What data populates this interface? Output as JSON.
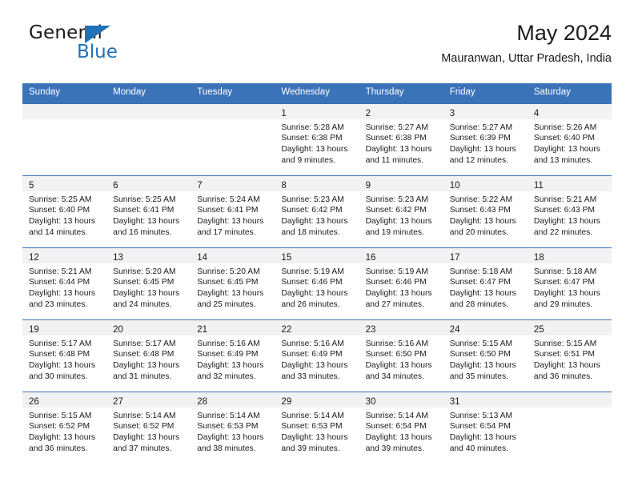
{
  "brand": {
    "word_one": "General",
    "word_two": "Blue",
    "triangle_icon": "triangle-icon",
    "accent_color": "#1f71b8"
  },
  "header": {
    "title": "May 2024",
    "subtitle": "Mauranwan, Uttar Pradesh, India"
  },
  "theme": {
    "header_blue": "#3b73b9",
    "daynum_band": "#f2f2f2",
    "text": "#1b1b1b"
  },
  "calendar": {
    "weekday_headers": [
      "Sunday",
      "Monday",
      "Tuesday",
      "Wednesday",
      "Thursday",
      "Friday",
      "Saturday"
    ],
    "weeks": [
      [
        {
          "day": "",
          "sunrise": "",
          "sunset": "",
          "daylight": ""
        },
        {
          "day": "",
          "sunrise": "",
          "sunset": "",
          "daylight": ""
        },
        {
          "day": "",
          "sunrise": "",
          "sunset": "",
          "daylight": ""
        },
        {
          "day": "1",
          "sunrise": "Sunrise: 5:28 AM",
          "sunset": "Sunset: 6:38 PM",
          "daylight": "Daylight: 13 hours and 9 minutes."
        },
        {
          "day": "2",
          "sunrise": "Sunrise: 5:27 AM",
          "sunset": "Sunset: 6:38 PM",
          "daylight": "Daylight: 13 hours and 11 minutes."
        },
        {
          "day": "3",
          "sunrise": "Sunrise: 5:27 AM",
          "sunset": "Sunset: 6:39 PM",
          "daylight": "Daylight: 13 hours and 12 minutes."
        },
        {
          "day": "4",
          "sunrise": "Sunrise: 5:26 AM",
          "sunset": "Sunset: 6:40 PM",
          "daylight": "Daylight: 13 hours and 13 minutes."
        }
      ],
      [
        {
          "day": "5",
          "sunrise": "Sunrise: 5:25 AM",
          "sunset": "Sunset: 6:40 PM",
          "daylight": "Daylight: 13 hours and 14 minutes."
        },
        {
          "day": "6",
          "sunrise": "Sunrise: 5:25 AM",
          "sunset": "Sunset: 6:41 PM",
          "daylight": "Daylight: 13 hours and 16 minutes."
        },
        {
          "day": "7",
          "sunrise": "Sunrise: 5:24 AM",
          "sunset": "Sunset: 6:41 PM",
          "daylight": "Daylight: 13 hours and 17 minutes."
        },
        {
          "day": "8",
          "sunrise": "Sunrise: 5:23 AM",
          "sunset": "Sunset: 6:42 PM",
          "daylight": "Daylight: 13 hours and 18 minutes."
        },
        {
          "day": "9",
          "sunrise": "Sunrise: 5:23 AM",
          "sunset": "Sunset: 6:42 PM",
          "daylight": "Daylight: 13 hours and 19 minutes."
        },
        {
          "day": "10",
          "sunrise": "Sunrise: 5:22 AM",
          "sunset": "Sunset: 6:43 PM",
          "daylight": "Daylight: 13 hours and 20 minutes."
        },
        {
          "day": "11",
          "sunrise": "Sunrise: 5:21 AM",
          "sunset": "Sunset: 6:43 PM",
          "daylight": "Daylight: 13 hours and 22 minutes."
        }
      ],
      [
        {
          "day": "12",
          "sunrise": "Sunrise: 5:21 AM",
          "sunset": "Sunset: 6:44 PM",
          "daylight": "Daylight: 13 hours and 23 minutes."
        },
        {
          "day": "13",
          "sunrise": "Sunrise: 5:20 AM",
          "sunset": "Sunset: 6:45 PM",
          "daylight": "Daylight: 13 hours and 24 minutes."
        },
        {
          "day": "14",
          "sunrise": "Sunrise: 5:20 AM",
          "sunset": "Sunset: 6:45 PM",
          "daylight": "Daylight: 13 hours and 25 minutes."
        },
        {
          "day": "15",
          "sunrise": "Sunrise: 5:19 AM",
          "sunset": "Sunset: 6:46 PM",
          "daylight": "Daylight: 13 hours and 26 minutes."
        },
        {
          "day": "16",
          "sunrise": "Sunrise: 5:19 AM",
          "sunset": "Sunset: 6:46 PM",
          "daylight": "Daylight: 13 hours and 27 minutes."
        },
        {
          "day": "17",
          "sunrise": "Sunrise: 5:18 AM",
          "sunset": "Sunset: 6:47 PM",
          "daylight": "Daylight: 13 hours and 28 minutes."
        },
        {
          "day": "18",
          "sunrise": "Sunrise: 5:18 AM",
          "sunset": "Sunset: 6:47 PM",
          "daylight": "Daylight: 13 hours and 29 minutes."
        }
      ],
      [
        {
          "day": "19",
          "sunrise": "Sunrise: 5:17 AM",
          "sunset": "Sunset: 6:48 PM",
          "daylight": "Daylight: 13 hours and 30 minutes."
        },
        {
          "day": "20",
          "sunrise": "Sunrise: 5:17 AM",
          "sunset": "Sunset: 6:48 PM",
          "daylight": "Daylight: 13 hours and 31 minutes."
        },
        {
          "day": "21",
          "sunrise": "Sunrise: 5:16 AM",
          "sunset": "Sunset: 6:49 PM",
          "daylight": "Daylight: 13 hours and 32 minutes."
        },
        {
          "day": "22",
          "sunrise": "Sunrise: 5:16 AM",
          "sunset": "Sunset: 6:49 PM",
          "daylight": "Daylight: 13 hours and 33 minutes."
        },
        {
          "day": "23",
          "sunrise": "Sunrise: 5:16 AM",
          "sunset": "Sunset: 6:50 PM",
          "daylight": "Daylight: 13 hours and 34 minutes."
        },
        {
          "day": "24",
          "sunrise": "Sunrise: 5:15 AM",
          "sunset": "Sunset: 6:50 PM",
          "daylight": "Daylight: 13 hours and 35 minutes."
        },
        {
          "day": "25",
          "sunrise": "Sunrise: 5:15 AM",
          "sunset": "Sunset: 6:51 PM",
          "daylight": "Daylight: 13 hours and 36 minutes."
        }
      ],
      [
        {
          "day": "26",
          "sunrise": "Sunrise: 5:15 AM",
          "sunset": "Sunset: 6:52 PM",
          "daylight": "Daylight: 13 hours and 36 minutes."
        },
        {
          "day": "27",
          "sunrise": "Sunrise: 5:14 AM",
          "sunset": "Sunset: 6:52 PM",
          "daylight": "Daylight: 13 hours and 37 minutes."
        },
        {
          "day": "28",
          "sunrise": "Sunrise: 5:14 AM",
          "sunset": "Sunset: 6:53 PM",
          "daylight": "Daylight: 13 hours and 38 minutes."
        },
        {
          "day": "29",
          "sunrise": "Sunrise: 5:14 AM",
          "sunset": "Sunset: 6:53 PM",
          "daylight": "Daylight: 13 hours and 39 minutes."
        },
        {
          "day": "30",
          "sunrise": "Sunrise: 5:14 AM",
          "sunset": "Sunset: 6:54 PM",
          "daylight": "Daylight: 13 hours and 39 minutes."
        },
        {
          "day": "31",
          "sunrise": "Sunrise: 5:13 AM",
          "sunset": "Sunset: 6:54 PM",
          "daylight": "Daylight: 13 hours and 40 minutes."
        },
        {
          "day": "",
          "sunrise": "",
          "sunset": "",
          "daylight": ""
        }
      ]
    ]
  }
}
